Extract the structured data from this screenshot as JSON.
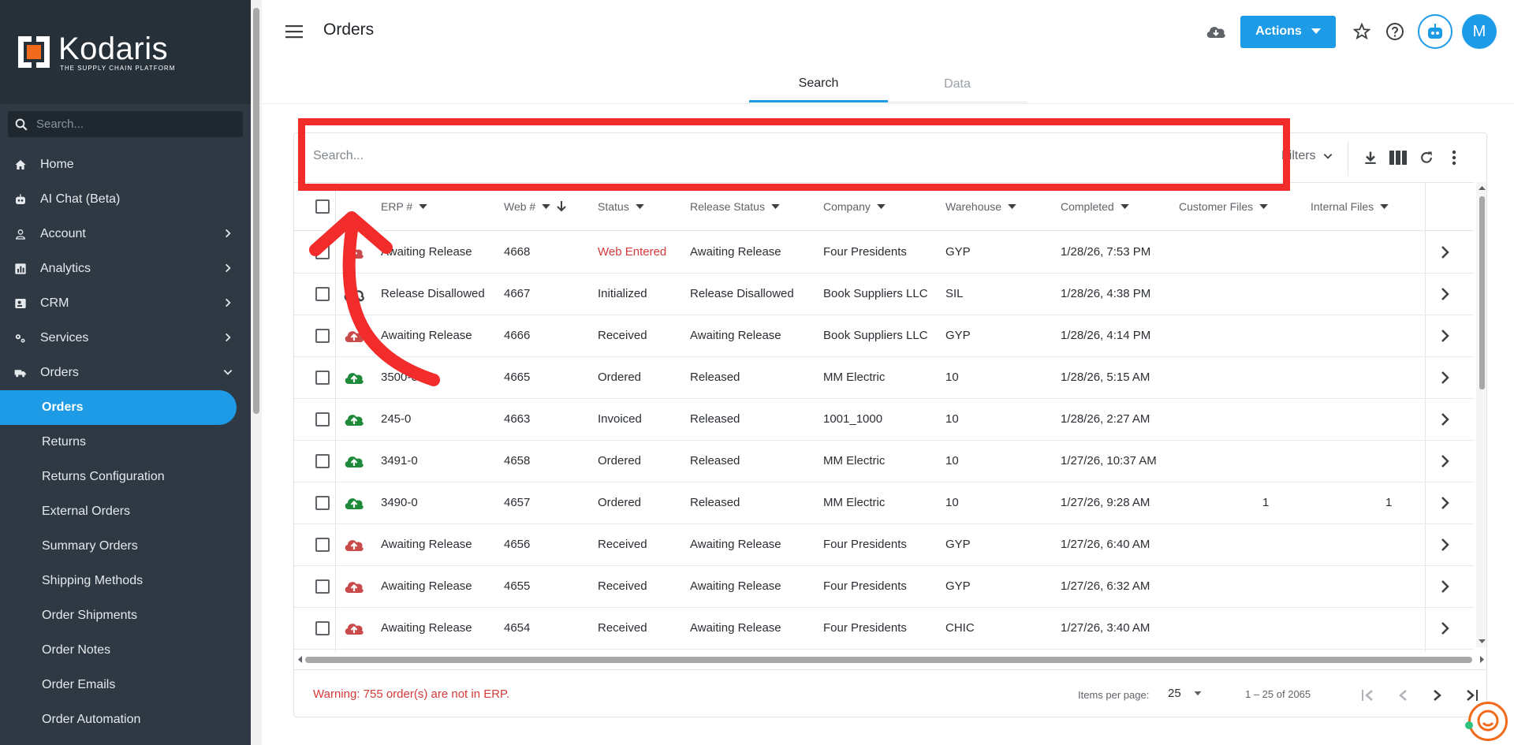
{
  "brand": {
    "name": "Kodaris",
    "tagline": "THE SUPPLY CHAIN PLATFORM"
  },
  "sidebar": {
    "search_placeholder": "Search...",
    "items": [
      {
        "label": "Home",
        "icon": "home-icon",
        "chevron": false
      },
      {
        "label": "AI Chat (Beta)",
        "icon": "robot-icon",
        "chevron": false
      },
      {
        "label": "Account",
        "icon": "person-icon",
        "chevron": true
      },
      {
        "label": "Analytics",
        "icon": "chart-icon",
        "chevron": true
      },
      {
        "label": "CRM",
        "icon": "contact-card-icon",
        "chevron": true
      },
      {
        "label": "Services",
        "icon": "gears-icon",
        "chevron": true
      },
      {
        "label": "Orders",
        "icon": "truck-icon",
        "chevron": "down"
      }
    ],
    "sub_items": [
      {
        "label": "Orders",
        "active": true
      },
      {
        "label": "Returns"
      },
      {
        "label": "Returns Configuration"
      },
      {
        "label": "External Orders"
      },
      {
        "label": "Summary Orders"
      },
      {
        "label": "Shipping Methods"
      },
      {
        "label": "Order Shipments"
      },
      {
        "label": "Order Notes"
      },
      {
        "label": "Order Emails"
      },
      {
        "label": "Order Automation"
      }
    ]
  },
  "header": {
    "title": "Orders",
    "actions_label": "Actions",
    "avatar_initial": "M"
  },
  "tabs": [
    {
      "label": "Search",
      "active": true
    },
    {
      "label": "Data",
      "active": false
    }
  ],
  "toolbar": {
    "search_placeholder": "Search...",
    "filters_label": "Filters"
  },
  "table": {
    "columns": [
      "ERP #",
      "Web #",
      "Status",
      "Release Status",
      "Company",
      "Warehouse",
      "Completed",
      "Customer Files",
      "Internal Files"
    ],
    "rows": [
      {
        "erp": "Awaiting Release",
        "web": "4668",
        "status": "Web Entered",
        "release": "Awaiting Release",
        "company": "Four Presidents",
        "warehouse": "GYP",
        "completed": "1/28/26, 7:53 PM",
        "cust_files": "",
        "int_files": "",
        "cloud": "red-upload"
      },
      {
        "erp": "Release Disallowed",
        "web": "4667",
        "status": "Initialized",
        "release": "Release Disallowed",
        "company": "Book Suppliers LLC",
        "warehouse": "SIL",
        "completed": "1/28/26, 4:38 PM",
        "cust_files": "",
        "int_files": "",
        "cloud": "cloud-off"
      },
      {
        "erp": "Awaiting Release",
        "web": "4666",
        "status": "Received",
        "release": "Awaiting Release",
        "company": "Book Suppliers LLC",
        "warehouse": "GYP",
        "completed": "1/28/26, 4:14 PM",
        "cust_files": "",
        "int_files": "",
        "cloud": "red-upload"
      },
      {
        "erp": "3500-0",
        "web": "4665",
        "status": "Ordered",
        "release": "Released",
        "company": "MM Electric",
        "warehouse": "10",
        "completed": "1/28/26, 5:15 AM",
        "cust_files": "",
        "int_files": "",
        "cloud": "green-upload"
      },
      {
        "erp": "245-0",
        "web": "4663",
        "status": "Invoiced",
        "release": "Released",
        "company": "1001_1000",
        "warehouse": "10",
        "completed": "1/28/26, 2:27 AM",
        "cust_files": "",
        "int_files": "",
        "cloud": "green-upload"
      },
      {
        "erp": "3491-0",
        "web": "4658",
        "status": "Ordered",
        "release": "Released",
        "company": "MM Electric",
        "warehouse": "10",
        "completed": "1/27/26, 10:37 AM",
        "cust_files": "",
        "int_files": "",
        "cloud": "green-upload"
      },
      {
        "erp": "3490-0",
        "web": "4657",
        "status": "Ordered",
        "release": "Released",
        "company": "MM Electric",
        "warehouse": "10",
        "completed": "1/27/26, 9:28 AM",
        "cust_files": "1",
        "int_files": "1",
        "cloud": "green-upload"
      },
      {
        "erp": "Awaiting Release",
        "web": "4656",
        "status": "Received",
        "release": "Awaiting Release",
        "company": "Four Presidents",
        "warehouse": "GYP",
        "completed": "1/27/26, 6:40 AM",
        "cust_files": "",
        "int_files": "",
        "cloud": "red-upload"
      },
      {
        "erp": "Awaiting Release",
        "web": "4655",
        "status": "Received",
        "release": "Awaiting Release",
        "company": "Four Presidents",
        "warehouse": "GYP",
        "completed": "1/27/26, 6:32 AM",
        "cust_files": "",
        "int_files": "",
        "cloud": "red-upload"
      },
      {
        "erp": "Awaiting Release",
        "web": "4654",
        "status": "Received",
        "release": "Awaiting Release",
        "company": "Four Presidents",
        "warehouse": "CHIC",
        "completed": "1/27/26, 3:40 AM",
        "cust_files": "",
        "int_files": "",
        "cloud": "red-upload"
      }
    ]
  },
  "footer": {
    "warning": "Warning: 755 order(s) are not in ERP.",
    "items_per_page_label": "Items per page:",
    "items_per_page": "25",
    "range": "1 – 25 of 2065"
  },
  "colors": {
    "accent": "#1e9be6",
    "sidebar": "#2e3944",
    "warning": "#d43a3a",
    "annotation": "#f22b2b",
    "cloud_green": "#1f8a3a",
    "cloud_red": "#c94a4a"
  }
}
